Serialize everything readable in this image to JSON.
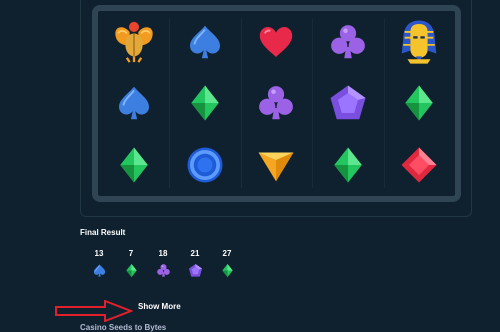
{
  "grid": {
    "rows": [
      [
        "scarab-icon",
        "spade-blue-icon",
        "heart-red-icon",
        "club-purple-icon",
        "pharaoh-icon"
      ],
      [
        "spade-blue-icon",
        "diamond-green-icon",
        "club-purple-icon",
        "gem-purple-icon",
        "diamond-green-icon"
      ],
      [
        "diamond-green-icon",
        "coin-blue-icon",
        "gem-yellow-icon",
        "diamond-green-icon",
        "gem-red-icon"
      ]
    ]
  },
  "result": {
    "title": "Final Result",
    "items": [
      {
        "count": "13",
        "icon": "spade-blue-icon"
      },
      {
        "count": "7",
        "icon": "diamond-green-icon"
      },
      {
        "count": "18",
        "icon": "club-purple-icon"
      },
      {
        "count": "21",
        "icon": "gem-purple-icon"
      },
      {
        "count": "27",
        "icon": "diamond-green-icon"
      }
    ]
  },
  "show_more_label": "Show More",
  "footer_label": "Casino Seeds to Bytes",
  "colors": {
    "background": "#0f212e",
    "frame": "#2f4553",
    "annotation_arrow": "#e0202a"
  }
}
